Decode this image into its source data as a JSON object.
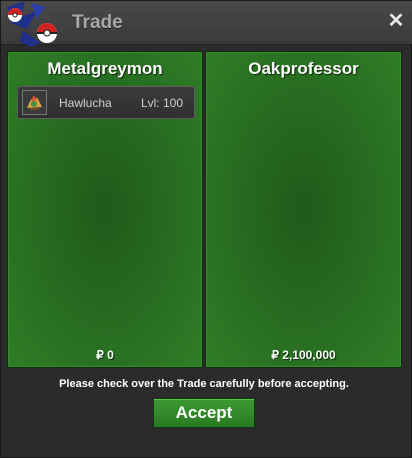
{
  "window": {
    "title": "Trade",
    "close_symbol": "✕"
  },
  "left_panel": {
    "player_name": "Metalgreymon",
    "items": [
      {
        "name": "Hawlucha",
        "level": "Lvl: 100",
        "icon": "hawlucha-sprite-icon"
      }
    ],
    "money": "₽ 0"
  },
  "right_panel": {
    "player_name": "Oakprofessor",
    "items": [],
    "money": "₽ 2,100,000"
  },
  "footer": {
    "notice": "Please check over the Trade carefully before accepting.",
    "accept_label": "Accept"
  },
  "colors": {
    "panel_green": "#286d21",
    "button_green": "#3c9a31",
    "title_gray": "#a8a8a8"
  }
}
